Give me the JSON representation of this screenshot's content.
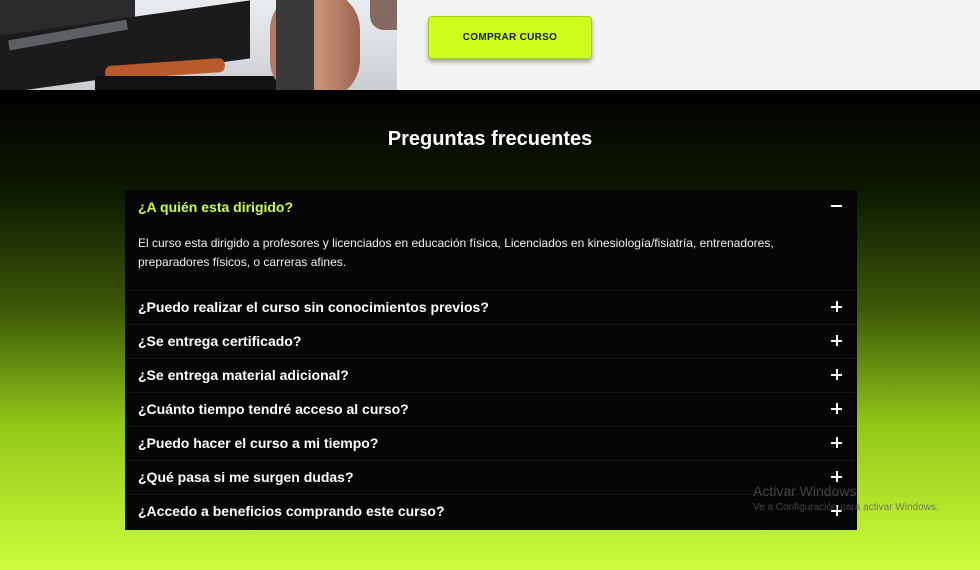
{
  "hero": {
    "buy_button_label": "COMPRAR CURSO"
  },
  "faq": {
    "title": "Preguntas frecuentes",
    "open_item": {
      "question": "¿A quién esta dirigido?",
      "answer": "El curso esta dirigido a profesores y licenciados en educación física, Licenciados en kinesiología/fisiatría, entrenadores, preparadores físicos, o carreras afines.",
      "toggle_icon": "minus-icon"
    },
    "items": [
      {
        "question": "¿Puedo realizar el curso sin conocimientos previos?",
        "toggle_icon": "plus-icon"
      },
      {
        "question": "¿Se entrega certificado?",
        "toggle_icon": "plus-icon"
      },
      {
        "question": "¿Se entrega material adicional?",
        "toggle_icon": "plus-icon"
      },
      {
        "question": "¿Cuánto tiempo tendré acceso al curso?",
        "toggle_icon": "plus-icon"
      },
      {
        "question": "¿Puedo hacer el curso a mi tiempo?",
        "toggle_icon": "plus-icon"
      },
      {
        "question": "¿Qué pasa si me surgen dudas?",
        "toggle_icon": "plus-icon"
      },
      {
        "question": "¿Accedo a beneficios comprando este curso?",
        "toggle_icon": "plus-icon"
      }
    ]
  },
  "watermark": {
    "title": "Activar Windows",
    "subtitle": "Ve a Configuración para activar Windows."
  },
  "colors": {
    "accent": "#cdfd3c",
    "faq_box": "#050505",
    "gradient_top": "#000000",
    "gradient_bottom": "#cdfd3c"
  }
}
